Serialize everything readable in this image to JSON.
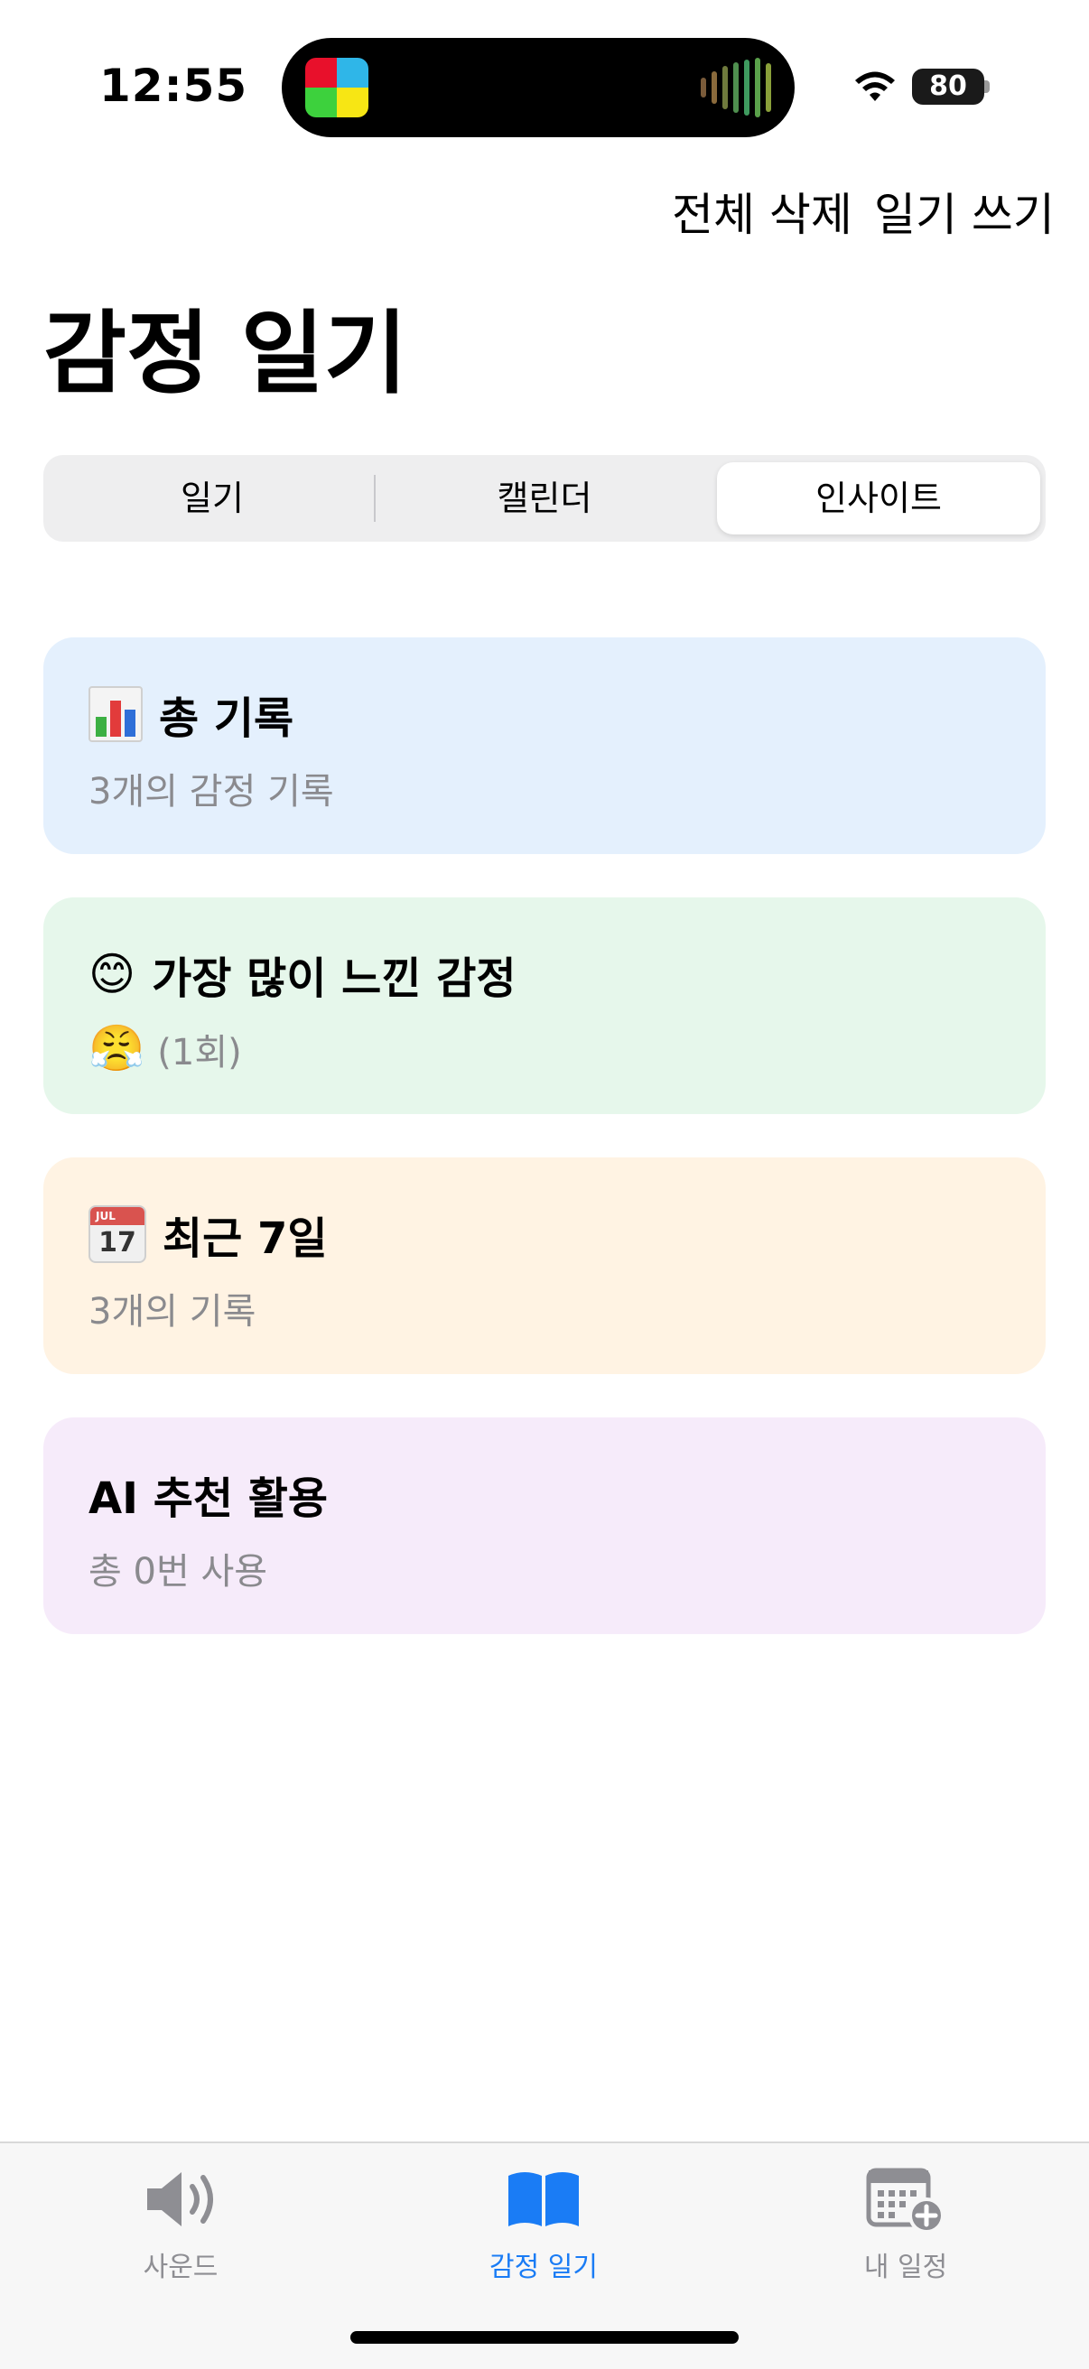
{
  "status_bar": {
    "time": "12:55",
    "battery": "80"
  },
  "header": {
    "delete_all": "전체 삭제",
    "write_diary": "일기 쓰기",
    "title": "감정 일기"
  },
  "segments": {
    "items": [
      "일기",
      "캘린더",
      "인사이트"
    ],
    "selected": "인사이트"
  },
  "cards": [
    {
      "emoji": "📊",
      "icon": "bar-chart-icon",
      "title": "총 기록",
      "subtitle": "3개의 감정 기록",
      "color": "#e4f0fd"
    },
    {
      "emoji": "😊",
      "icon": "smiling-face-icon",
      "title": "가장 많이 느낀 감정",
      "sub_emoji": "😤",
      "subtitle": "(1회)",
      "color": "#e6f7eb"
    },
    {
      "emoji": "📅",
      "icon": "calendar-icon",
      "title": "최근 7일",
      "subtitle": "3개의 기록",
      "color": "#fff3e3"
    },
    {
      "title": "AI 추천 활용",
      "subtitle": "총 0번 사용",
      "color": "#f6ebfa"
    }
  ],
  "tab_bar": {
    "items": [
      {
        "label": "사운드",
        "icon": "speaker-icon"
      },
      {
        "label": "감정 일기",
        "icon": "book-icon"
      },
      {
        "label": "내 일정",
        "icon": "calendar-add-icon"
      }
    ],
    "active": "감정 일기",
    "active_color": "#1a7cf5",
    "inactive_color": "#8e8e93"
  }
}
